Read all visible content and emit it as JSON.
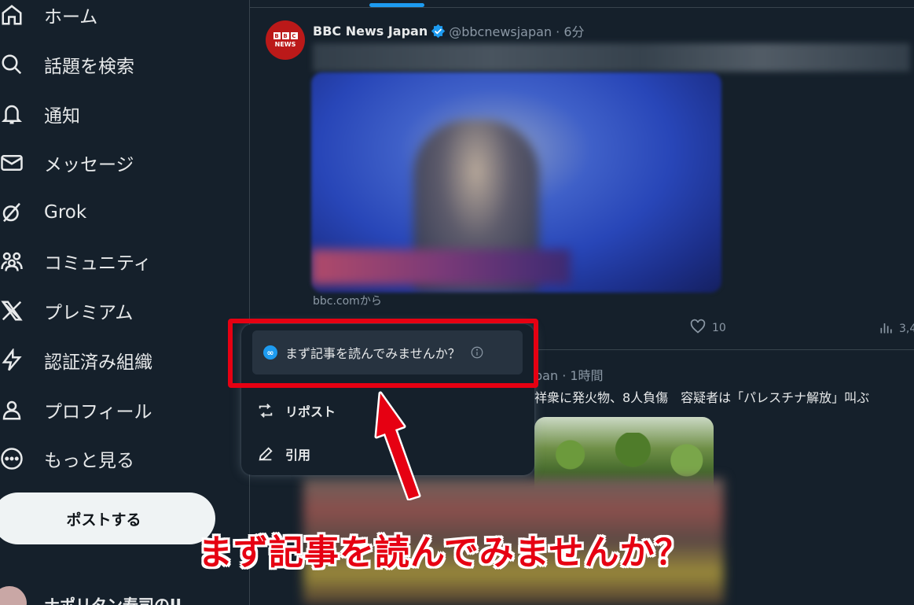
{
  "sidebar": {
    "items": [
      {
        "label": "ホーム",
        "icon": "home-icon"
      },
      {
        "label": "話題を検索",
        "icon": "search-icon"
      },
      {
        "label": "通知",
        "icon": "bell-icon"
      },
      {
        "label": "メッセージ",
        "icon": "mail-icon"
      },
      {
        "label": "Grok",
        "icon": "grok-icon"
      },
      {
        "label": "コミュニティ",
        "icon": "community-icon"
      },
      {
        "label": "プレミアム",
        "icon": "x-logo-icon"
      },
      {
        "label": "認証済み組織",
        "icon": "lightning-icon"
      },
      {
        "label": "プロフィール",
        "icon": "person-icon"
      },
      {
        "label": "もっと見る",
        "icon": "more-circle-icon"
      }
    ],
    "post_button": "ポストする",
    "profile_name": "ナポリタン寿司のII"
  },
  "tweet1": {
    "author_name": "BBC News Japan",
    "handle_time": "@bbcnewsjapan · 6分",
    "avatar_text": "NEWS",
    "avatar_blocks": [
      "B",
      "B",
      "C"
    ],
    "media_source": "bbc.comから",
    "like_count": "10",
    "views_count": "3,4"
  },
  "tweet2": {
    "handle_time": "pan · 1時間",
    "text": "祥衆に発火物、8人負傷　容疑者は「パレスチナ解放」叫ぶ"
  },
  "repost_menu": {
    "prompt": "まず記事を読んでみませんか？",
    "repost_label": "リポスト",
    "quote_label": "引用"
  },
  "annotation": {
    "caption": "まず記事を読んでみませんか？",
    "highlight_color": "#e60012"
  },
  "colors": {
    "background": "#15202b",
    "accent": "#1d9bf0",
    "text_secondary": "#8b98a5"
  }
}
